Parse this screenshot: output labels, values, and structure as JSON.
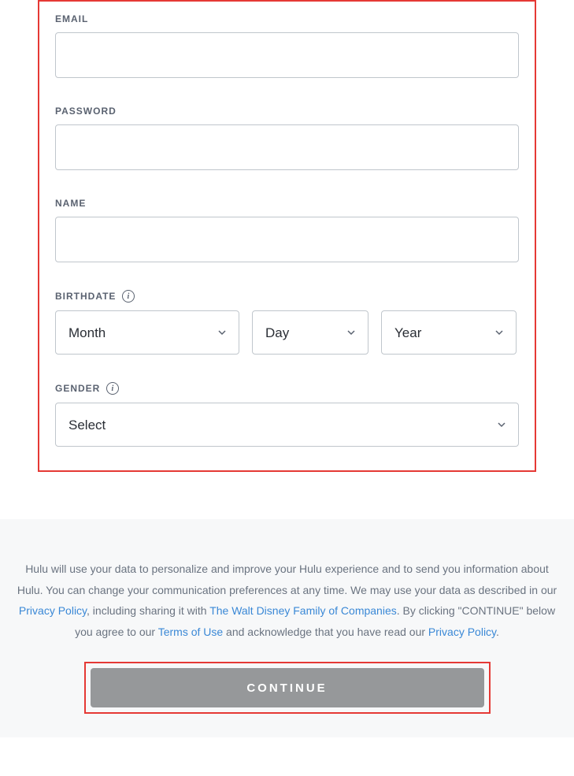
{
  "form": {
    "email": {
      "label": "EMAIL",
      "value": ""
    },
    "password": {
      "label": "PASSWORD",
      "value": ""
    },
    "name": {
      "label": "NAME",
      "value": ""
    },
    "birthdate": {
      "label": "BIRTHDATE",
      "month": {
        "selected": "Month"
      },
      "day": {
        "selected": "Day"
      },
      "year": {
        "selected": "Year"
      }
    },
    "gender": {
      "label": "GENDER",
      "selected": "Select"
    }
  },
  "footer": {
    "text1": "Hulu will use your data to personalize and improve your Hulu experience and to send you information about Hulu. You can change your communication preferences at any time. We may use your data as described in our ",
    "privacy1": "Privacy Policy",
    "text2": ", including sharing it with ",
    "disney": "The Walt Disney Family of Companies",
    "text3": ". By clicking \"CONTINUE\" below you agree to our ",
    "terms": "Terms of Use",
    "text4": " and acknowledge that you have read our ",
    "privacy2": "Privacy Policy",
    "text5": "."
  },
  "continue_label": "CONTINUE"
}
